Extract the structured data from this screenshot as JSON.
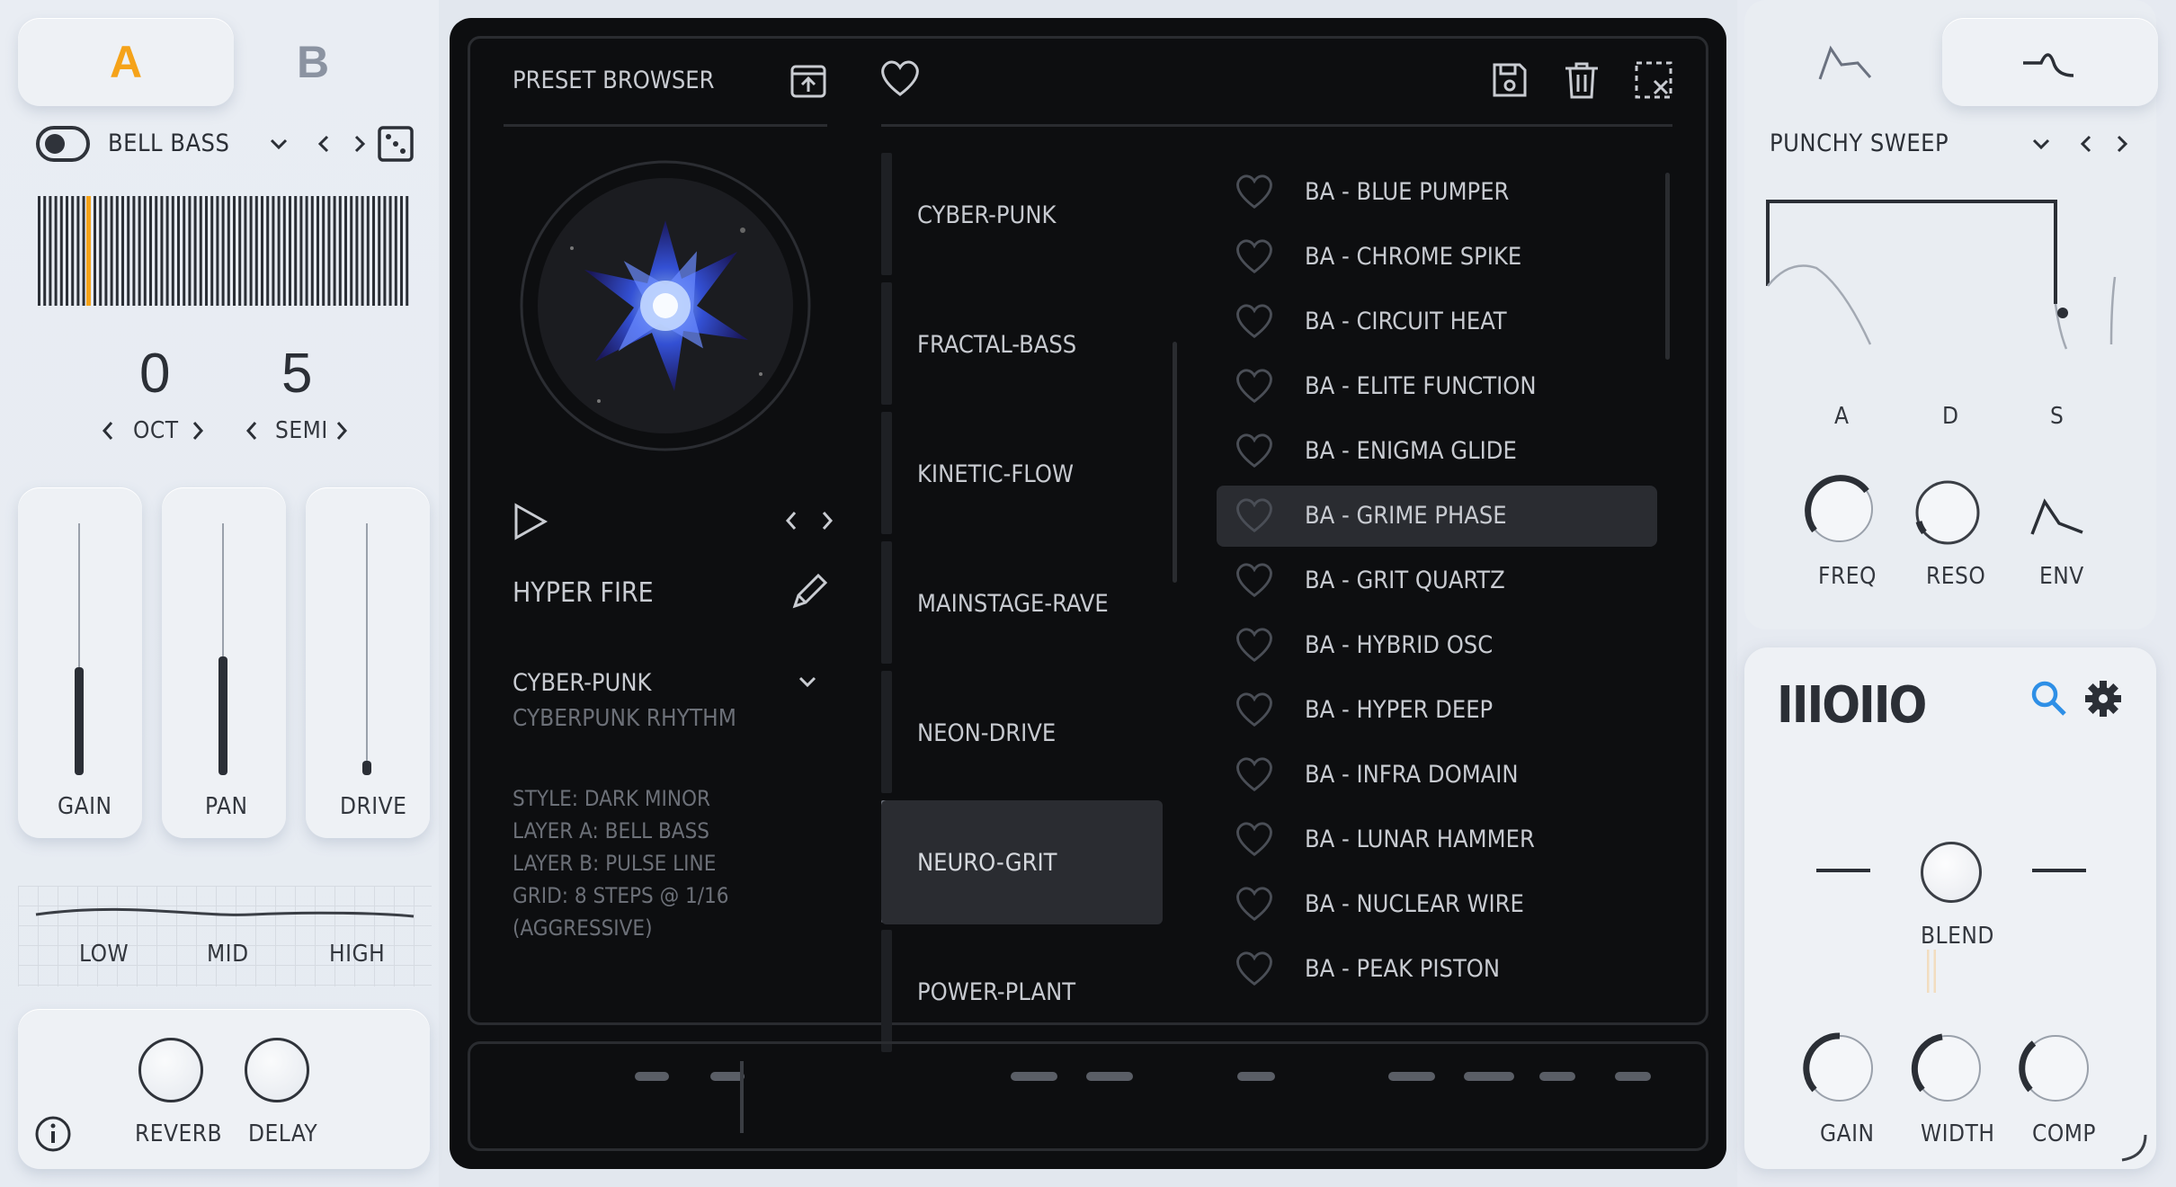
{
  "layer_tabs": {
    "a": "A",
    "b": "B"
  },
  "layer": {
    "preset_name": "BELL BASS",
    "octave": {
      "value": "0",
      "label": "OCT"
    },
    "semi": {
      "value": "5",
      "label": "SEMI"
    }
  },
  "faders": [
    {
      "label": "GAIN",
      "level": 0.43
    },
    {
      "label": "PAN",
      "level": 0.47
    },
    {
      "label": "DRIVE",
      "level": 0.03
    }
  ],
  "eq": {
    "low": "LOW",
    "mid": "MID",
    "high": "HIGH"
  },
  "fx": {
    "reverb": "REVERB",
    "delay": "DELAY"
  },
  "browser": {
    "title": "PRESET BROWSER",
    "current_preset": "HYPER FIRE",
    "category": "CYBER-PUNK",
    "subcategory": "CYBERPUNK RHYTHM",
    "description": [
      "STYLE: DARK MINOR",
      "LAYER A: BELL BASS",
      "LAYER B: PULSE LINE",
      "GRID: 8 STEPS @ 1/16",
      "(AGGRESSIVE)"
    ],
    "categories": [
      "CYBER-PUNK",
      "FRACTAL-BASS",
      "KINETIC-FLOW",
      "MAINSTAGE-RAVE",
      "NEON-DRIVE",
      "NEURO-GRIT",
      "POWER-PLANT"
    ],
    "selected_category": "NEURO-GRIT",
    "presets": [
      "BA - BLUE PUMPER",
      "BA - CHROME SPIKE",
      "BA - CIRCUIT HEAT",
      "BA - ELITE FUNCTION",
      "BA - ENIGMA GLIDE",
      "BA - GRIME PHASE",
      "BA - GRIT QUARTZ",
      "BA - HYBRID OSC",
      "BA - HYPER DEEP",
      "BA - INFRA DOMAIN",
      "BA - LUNAR HAMMER",
      "BA - NUCLEAR WIRE",
      "BA - PEAK PISTON"
    ],
    "selected_preset": "BA - GRIME PHASE"
  },
  "envelope": {
    "preset_name": "PUNCHY SWEEP",
    "labels": {
      "a": "A",
      "d": "D",
      "s": "S"
    },
    "knobs": {
      "freq": "FREQ",
      "reso": "RESO",
      "env": "ENV"
    }
  },
  "output": {
    "logo": "IIIOIIO",
    "blend": "BLEND",
    "knobs": {
      "gain": "GAIN",
      "width": "WIDTH",
      "comp": "COMP"
    }
  },
  "colors": {
    "accent": "#f5a31a",
    "search": "#2e8fe6",
    "panel": "#0d0e10",
    "selected": "#2a2c31"
  },
  "icons": [
    "upload-icon",
    "heart-icon",
    "save-icon",
    "trash-icon",
    "clear-selection-icon",
    "dice-icon",
    "play-icon",
    "edit-icon",
    "search-icon",
    "gear-icon",
    "info-icon"
  ]
}
